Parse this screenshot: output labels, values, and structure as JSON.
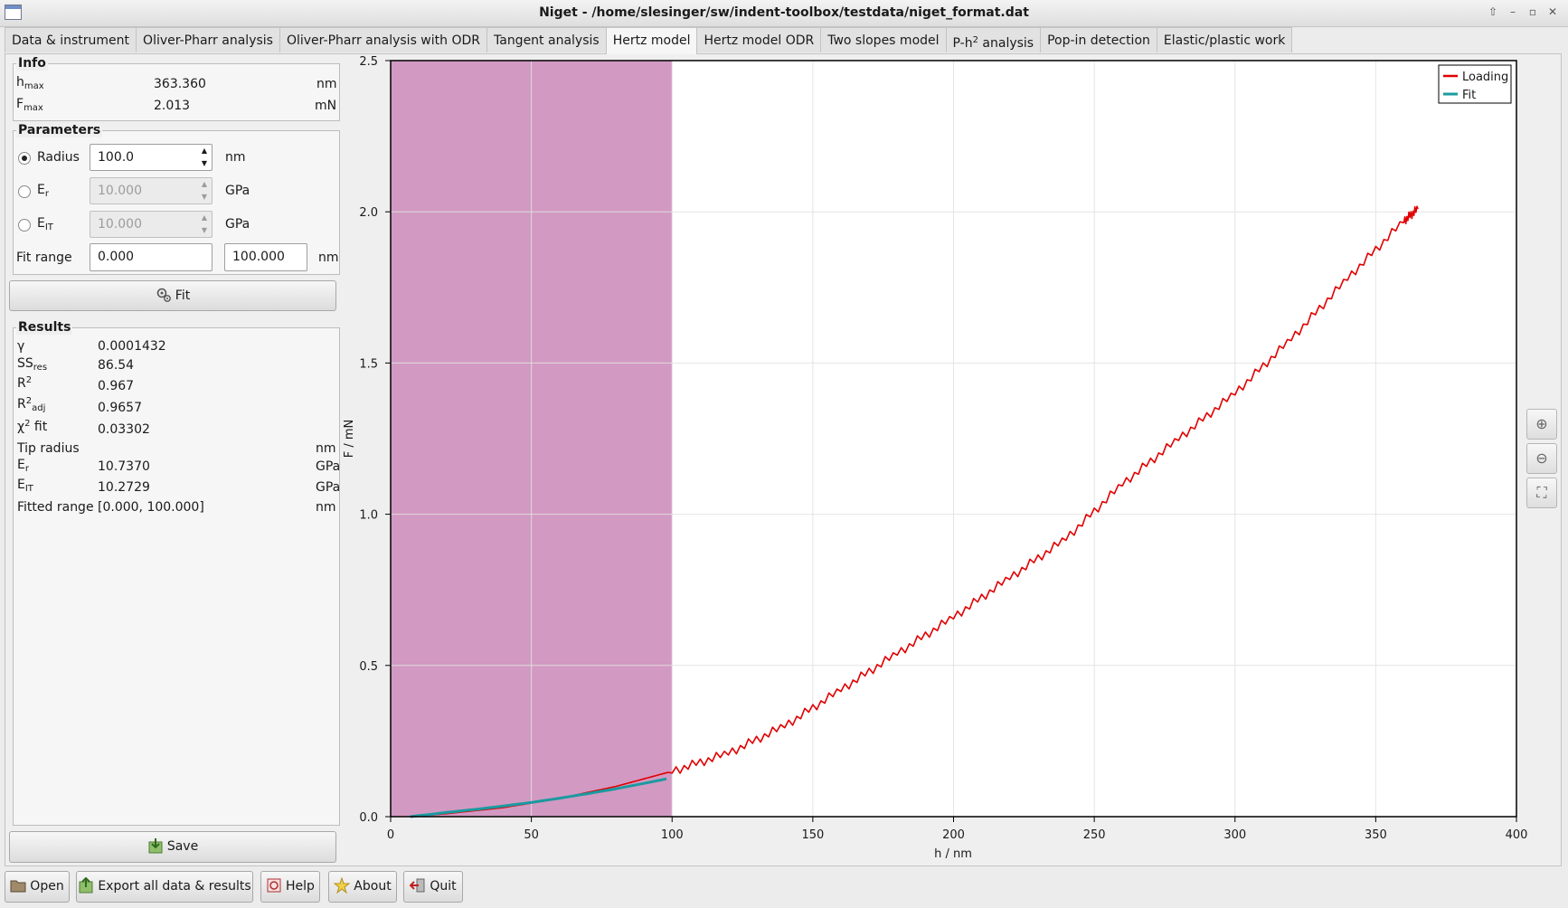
{
  "window": {
    "title": "Niget - /home/slesinger/sw/indent-toolbox/testdata/niget_format.dat",
    "controls": [
      "⇧",
      "–",
      "▫",
      "✕"
    ]
  },
  "tabs": [
    {
      "label": "Data & instrument",
      "active": false
    },
    {
      "label": "Oliver-Pharr analysis",
      "active": false
    },
    {
      "label": "Oliver-Pharr analysis with ODR",
      "active": false
    },
    {
      "label": "Tangent analysis",
      "active": false
    },
    {
      "label": "Hertz model",
      "active": true
    },
    {
      "label": "Hertz model ODR",
      "active": false
    },
    {
      "label": "Two slopes model",
      "active": false
    },
    {
      "label": "P-h",
      "sup": "2",
      "label_suffix": " analysis",
      "active": false
    },
    {
      "label": "Pop-in detection",
      "active": false
    },
    {
      "label": "Elastic/plastic work",
      "active": false
    }
  ],
  "info": {
    "title": "Info",
    "rows": [
      {
        "sym": "h",
        "sub": "max",
        "value": "363.360",
        "unit": "nm"
      },
      {
        "sym": "F",
        "sub": "max",
        "value": "2.013",
        "unit": "mN"
      }
    ]
  },
  "parameters": {
    "title": "Parameters",
    "radius": {
      "label": "Radius",
      "value": "100.0",
      "unit": "nm",
      "selected": true
    },
    "er": {
      "sym": "E",
      "sub": "r",
      "value": "10.000",
      "unit": "GPa",
      "selected": false
    },
    "eit": {
      "sym": "E",
      "sub": "IT",
      "value": "10.000",
      "unit": "GPa",
      "selected": false
    },
    "fit_range": {
      "label": "Fit range",
      "from": "0.000",
      "to": "100.000",
      "unit": "nm"
    }
  },
  "fit_button": {
    "label": "Fit"
  },
  "results": {
    "title": "Results",
    "gamma": {
      "sym": "γ",
      "value": "0.0001432"
    },
    "ssres": {
      "sym": "SS",
      "sub": "res",
      "value": "86.54"
    },
    "r2": {
      "sym": "R",
      "sup": "2",
      "value": "0.967"
    },
    "r2adj": {
      "sym": "R",
      "sup": "2",
      "sub": "adj",
      "value": "0.9657"
    },
    "chi2": {
      "sym": "χ",
      "sup": "2",
      "suffix": " fit",
      "value": "0.03302"
    },
    "tip_radius": {
      "label": "Tip radius",
      "value": "",
      "unit": "nm"
    },
    "er": {
      "sym": "E",
      "sub": "r",
      "value": "10.7370",
      "unit": "GPa"
    },
    "eit": {
      "sym": "E",
      "sub": "IT",
      "value": "10.2729",
      "unit": "GPa"
    },
    "fitted_range": {
      "label": "Fitted range",
      "value": "[0.000, 100.000]",
      "unit": "nm"
    }
  },
  "save_button": {
    "label": "Save"
  },
  "bottom_buttons": [
    {
      "label": "Open",
      "icon": "folder-icon"
    },
    {
      "label": "Export all data & results",
      "icon": "export-icon"
    },
    {
      "label": "Help",
      "icon": "help-icon"
    },
    {
      "label": "About",
      "icon": "star-icon"
    },
    {
      "label": "Quit",
      "icon": "quit-icon"
    }
  ],
  "side_tools": [
    {
      "name": "zoom-in-icon",
      "glyph": "⊕"
    },
    {
      "name": "zoom-out-icon",
      "glyph": "⊖"
    },
    {
      "name": "zoom-fit-icon",
      "glyph": "⛶"
    }
  ],
  "colors": {
    "loading": "#e00000",
    "fit": "#1a9aa0",
    "fit_region": "#d299c2"
  },
  "chart_data": {
    "type": "line",
    "xlabel": "h / nm",
    "ylabel": "F / mN",
    "xlim": [
      0,
      400
    ],
    "ylim": [
      0,
      2.5
    ],
    "xticks": [
      0,
      50,
      100,
      150,
      200,
      250,
      300,
      350,
      400
    ],
    "yticks": [
      0.0,
      0.5,
      1.0,
      1.5,
      2.0,
      2.5
    ],
    "ytick_labels": [
      "0.0",
      "0.5",
      "1.0",
      "1.5",
      "2.0",
      "2.5"
    ],
    "grid": true,
    "legend_position": "top-right",
    "highlight_region": {
      "x": [
        0,
        100
      ]
    },
    "series": [
      {
        "name": "Loading",
        "x": [
          7,
          20,
          40,
          60,
          80,
          100,
          120,
          140,
          160,
          180,
          200,
          220,
          240,
          260,
          280,
          300,
          320,
          340,
          360,
          365
        ],
        "y": [
          0.0,
          0.01,
          0.03,
          0.06,
          0.1,
          0.15,
          0.21,
          0.3,
          0.42,
          0.54,
          0.66,
          0.79,
          0.92,
          1.1,
          1.25,
          1.4,
          1.58,
          1.78,
          1.97,
          2.01
        ]
      },
      {
        "name": "Fit",
        "x": [
          7,
          20,
          30,
          40,
          50,
          60,
          70,
          80,
          90,
          98
        ],
        "y": [
          0.0,
          0.014,
          0.024,
          0.035,
          0.047,
          0.061,
          0.076,
          0.092,
          0.11,
          0.125
        ]
      }
    ]
  }
}
